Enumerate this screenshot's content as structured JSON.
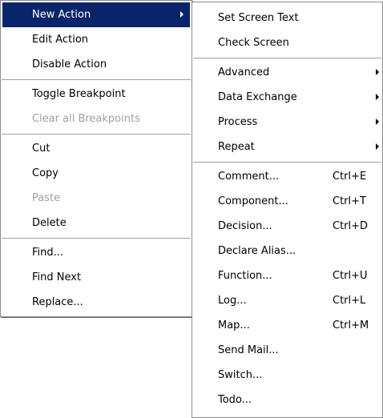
{
  "context_menu": {
    "new_action": "New Action",
    "edit_action": "Edit Action",
    "disable_action": "Disable Action",
    "toggle_breakpoint": "Toggle Breakpoint",
    "clear_all_breakpoints": "Clear all Breakpoints",
    "cut": "Cut",
    "copy": "Copy",
    "paste": "Paste",
    "delete": "Delete",
    "find": "Find...",
    "find_next": "Find Next",
    "replace": "Replace..."
  },
  "submenu": {
    "set_screen_text": "Set Screen Text",
    "check_screen": "Check Screen",
    "advanced": "Advanced",
    "data_exchange": "Data Exchange",
    "process": "Process",
    "repeat": "Repeat",
    "comment": {
      "label": "Comment...",
      "shortcut": "Ctrl+E"
    },
    "component": {
      "label": "Component...",
      "shortcut": "Ctrl+T"
    },
    "decision": {
      "label": "Decision...",
      "shortcut": "Ctrl+D"
    },
    "declare_alias": {
      "label": "Declare Alias..."
    },
    "function": {
      "label": "Function...",
      "shortcut": "Ctrl+U"
    },
    "log": {
      "label": "Log...",
      "shortcut": "Ctrl+L"
    },
    "map": {
      "label": "Map...",
      "shortcut": "Ctrl+M"
    },
    "send_mail": {
      "label": "Send Mail..."
    },
    "switch": {
      "label": "Switch..."
    },
    "todo": {
      "label": "Todo..."
    }
  },
  "colors": {
    "highlight_bg": "#0a246a",
    "highlight_text": "#ffffff",
    "disabled_text": "#a0a0a0",
    "menu_bg": "#ffffff"
  },
  "icons": [
    "submenu-arrow-icon"
  ]
}
